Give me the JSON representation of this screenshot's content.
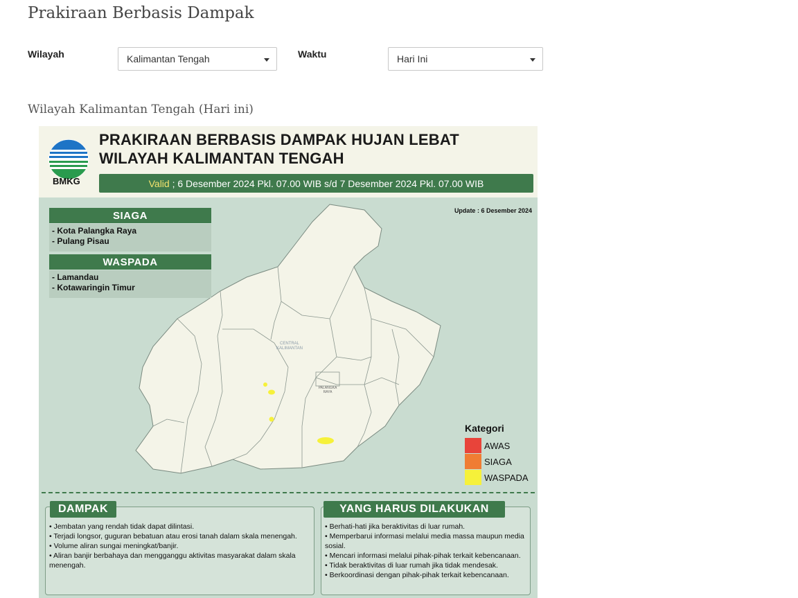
{
  "page": {
    "title": "Prakiraan Berbasis Dampak",
    "subtitle": "Wilayah Kalimantan Tengah (Hari ini)"
  },
  "filters": {
    "wilayah_label": "Wilayah",
    "wilayah_value": "Kalimantan Tengah",
    "waktu_label": "Waktu",
    "waktu_value": "Hari Ini"
  },
  "infographic": {
    "logo_text": "BMKG",
    "title_line1": "PRAKIRAAN BERBASIS DAMPAK HUJAN LEBAT",
    "title_line2": "WILAYAH KALIMANTAN TENGAH",
    "valid_word": "Valid",
    "valid_rest": " ; 6 Desember 2024 Pkl. 07.00 WIB s/d 7 Desember 2024 Pkl. 07.00 WIB",
    "update": "Update : 6 Desember 2024",
    "siaga": {
      "label": "SIAGA",
      "areas": [
        "- Kota Palangka Raya",
        "- Pulang Pisau"
      ]
    },
    "waspada": {
      "label": "WASPADA",
      "areas": [
        "- Lamandau",
        "- Kotawaringin Timur"
      ]
    },
    "map_labels": {
      "region_line1": "CENTRAL",
      "region_line2": "KALIMANTAN",
      "city_line1": "PALANGKA",
      "city_line2": "RAYA"
    },
    "legend": {
      "title": "Kategori",
      "items": [
        {
          "label": "AWAS",
          "color": "#e8443a"
        },
        {
          "label": "SIAGA",
          "color": "#f07d33"
        },
        {
          "label": "WASPADA",
          "color": "#f6f13a"
        }
      ]
    },
    "dampak": {
      "title": "DAMPAK",
      "items": [
        "• Jembatan yang rendah tidak dapat dilintasi.",
        "• Terjadi longsor, guguran bebatuan atau erosi tanah dalam skala menengah.",
        "• Volume aliran sungai meningkat/banjir.",
        "• Aliran banjir berbahaya dan mengganggu aktivitas masyarakat dalam skala menengah."
      ]
    },
    "tindakan": {
      "title": "YANG HARUS DILAKUKAN",
      "items": [
        "• Berhati-hati jika beraktivitas di luar rumah.",
        "• Memperbarui informasi melalui media massa maupun media sosial.",
        "• Mencari informasi melalui pihak-pihak terkait kebencanaan.",
        "• Tidak beraktivitas di luar rumah jika tidak mendesak.",
        "• Berkoordinasi dengan pihak-pihak terkait kebencanaan."
      ]
    },
    "colors": {
      "header_green": "#3f7a4c",
      "map_bg": "#c9dcd0",
      "land": "#f4f4e8",
      "warning_yellow": "#f6f13a"
    }
  }
}
